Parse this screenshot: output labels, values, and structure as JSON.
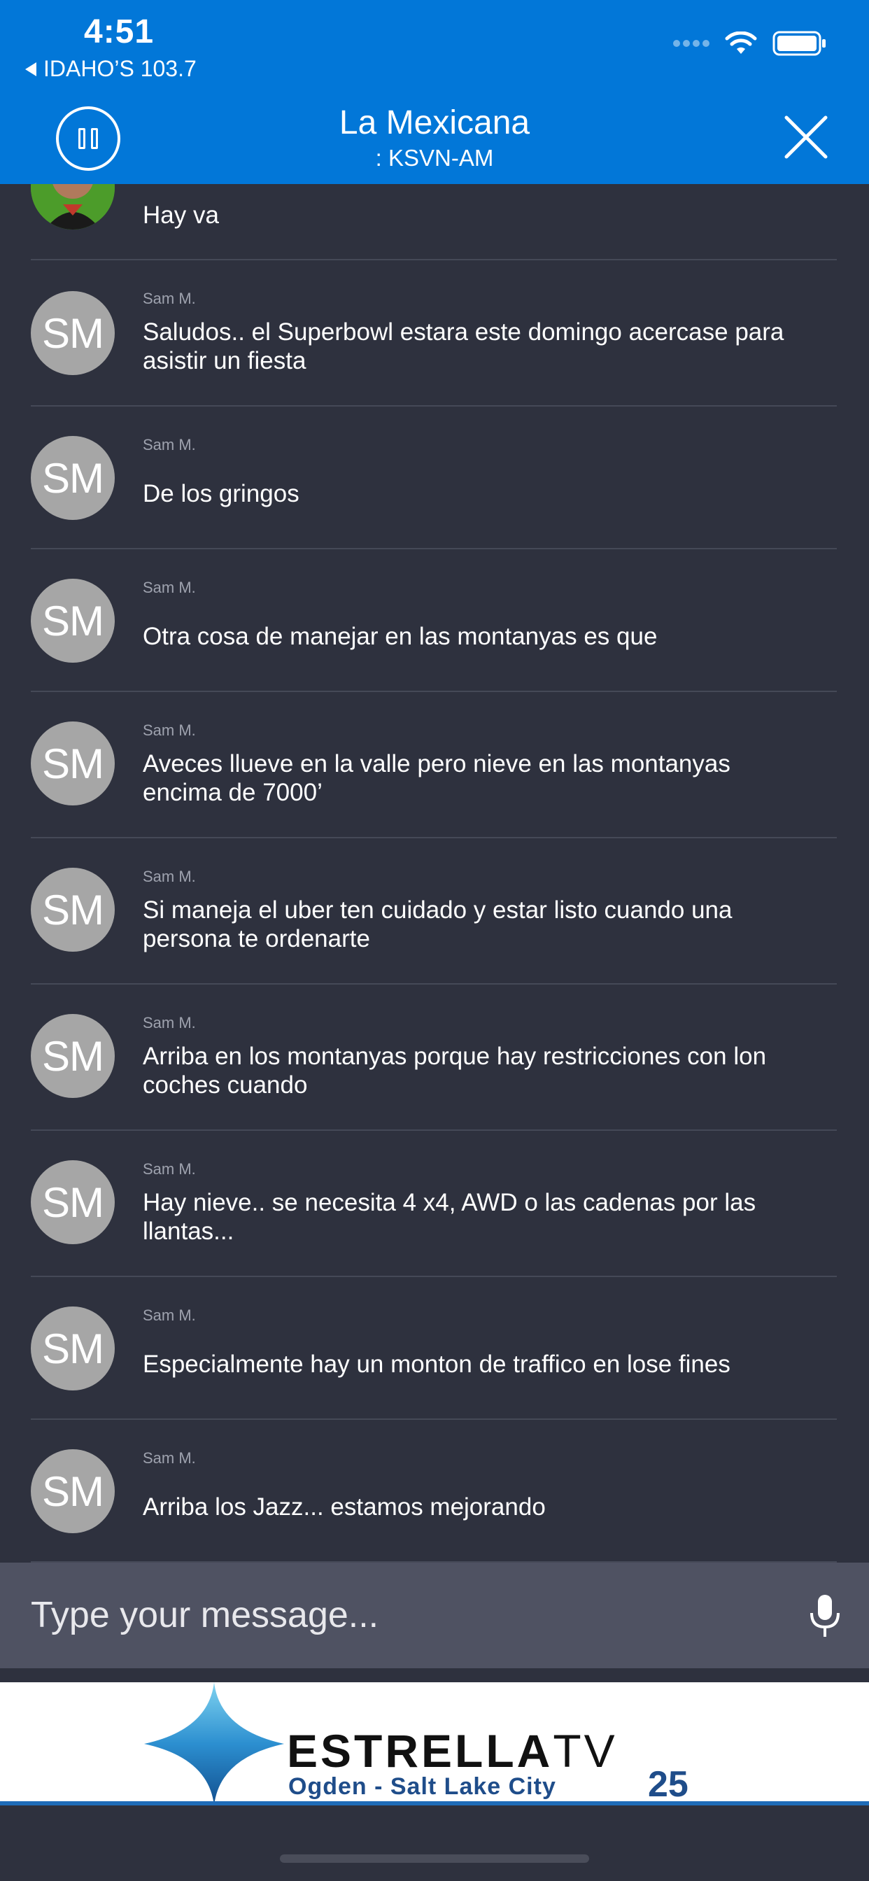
{
  "status_bar": {
    "time": "4:51",
    "back_app": "IDAHO’S 103.7"
  },
  "header": {
    "title": "La Mexicana",
    "subtitle": ": KSVN-AM",
    "pause_icon": "pause-icon",
    "close_icon": "close-icon"
  },
  "messages": [
    {
      "author": "",
      "avatar_type": "photo",
      "initials": "",
      "text": "Hay va"
    },
    {
      "author": "Sam M.",
      "initials": "SM",
      "text": "Saludos.. el Superbowl estara este domingo acercase para asistir un fiesta"
    },
    {
      "author": "Sam M.",
      "initials": "SM",
      "text": "De los gringos"
    },
    {
      "author": "Sam M.",
      "initials": "SM",
      "text": "Otra cosa de manejar en las montanyas es que"
    },
    {
      "author": "Sam M.",
      "initials": "SM",
      "text": "Aveces llueve en la valle pero nieve en las montanyas encima de 7000’"
    },
    {
      "author": "Sam M.",
      "initials": "SM",
      "text": "Si maneja el uber ten cuidado y estar listo cuando una persona te ordenarte"
    },
    {
      "author": "Sam M.",
      "initials": "SM",
      "text": "Arriba en los montanyas porque hay restricciones con lon coches cuando"
    },
    {
      "author": "Sam M.",
      "initials": "SM",
      "text": "Hay nieve.. se necesita 4 x4, AWD o las cadenas por las llantas..."
    },
    {
      "author": "Sam M.",
      "initials": "SM",
      "text": "Especialmente hay un monton de traffico en lose fines"
    },
    {
      "author": "Sam M.",
      "initials": "SM",
      "text": "Arriba los Jazz... estamos mejorando"
    }
  ],
  "composer": {
    "placeholder": "Type your message...",
    "mic_icon": "microphone-icon"
  },
  "ad": {
    "brand_bold": "ESTRELLA",
    "brand_light": "TV",
    "subtitle": "Ogden - Salt Lake City",
    "channel": "25"
  },
  "colors": {
    "header_blue": "#0277d8",
    "background": "#2e313e",
    "composer": "#4f5262",
    "avatar": "#a6a6a6"
  }
}
